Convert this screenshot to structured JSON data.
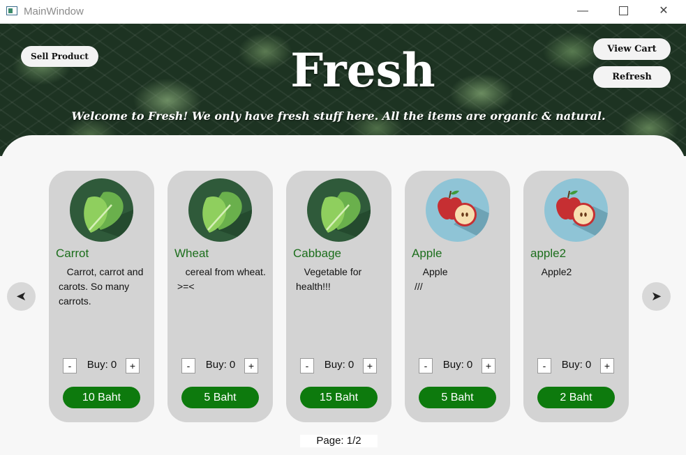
{
  "window": {
    "title": "MainWindow",
    "minimize": "—",
    "close": "✕"
  },
  "header": {
    "sell_label": "Sell Product",
    "cart_label": "View Cart",
    "refresh_label": "Refresh",
    "brand": "Fresh",
    "tagline": "Welcome to Fresh! We only have fresh stuff here. All the items are organic & natural."
  },
  "nav": {
    "prev": "➤",
    "next": "➤"
  },
  "products": [
    {
      "name": "Carrot",
      "description": "   Carrot, carrot and carots. So many carrots.",
      "buy_label": "Buy: 0",
      "minus": "-",
      "plus": "+",
      "price": "10 Baht",
      "icon": "leafy-vegetable-icon"
    },
    {
      "name": "Wheat",
      "description": "   cereal from wheat. >=<",
      "buy_label": "Buy: 0",
      "minus": "-",
      "plus": "+",
      "price": "5 Baht",
      "icon": "leafy-vegetable-icon"
    },
    {
      "name": "Cabbage",
      "description": "   Vegetable for health!!!",
      "buy_label": "Buy: 0",
      "minus": "-",
      "plus": "+",
      "price": "15 Baht",
      "icon": "leafy-vegetable-icon"
    },
    {
      "name": "Apple",
      "description": "   Apple\n///",
      "buy_label": "Buy: 0",
      "minus": "-",
      "plus": "+",
      "price": "5 Baht",
      "icon": "apple-icon"
    },
    {
      "name": "apple2",
      "description": "   Apple2",
      "buy_label": "Buy: 0",
      "minus": "-",
      "plus": "+",
      "price": "2 Baht",
      "icon": "apple-icon"
    }
  ],
  "pager": {
    "label": "Page: 1/2"
  },
  "colors": {
    "brand_green": "#0d7a0d",
    "name_green": "#1c6e1c",
    "card_bg": "#d3d3d3",
    "veg_icon_bg": "#2f5a3a",
    "fruit_icon_bg": "#8fc4d6"
  }
}
